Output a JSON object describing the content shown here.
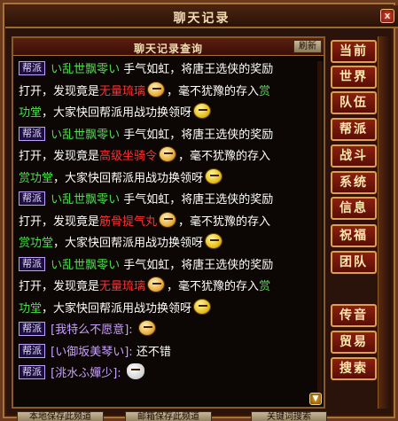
{
  "window": {
    "title": "聊天记录",
    "close_label": "x"
  },
  "panel": {
    "title": "聊天记录查询",
    "refresh_label": "刷新"
  },
  "channel_tag": "帮派",
  "messages": {
    "m1": {
      "player": "い乱世飘零い",
      "a": "手气如虹，将唐王选侠的奖励",
      "b": "打开，发现竟是",
      "item": "无量琉璃",
      "c": "，毫不犹豫的存入",
      "d": "赏",
      "e": "功堂",
      "f": "，大家快回帮派用战功换领呀"
    },
    "m2": {
      "player": "い乱世飘零い",
      "a": "手气如虹，将唐王选侠的奖励",
      "b": "打开，发现竟是",
      "item": "高级坐骑令",
      "c": "，毫不犹豫的存入",
      "d": "赏功堂",
      "f": "，大家快回帮派用战功换领呀"
    },
    "m3": {
      "player": "い乱世飘零い",
      "a": "手气如虹，将唐王选侠的奖励",
      "b": "打开，发现竟是",
      "item": "筋骨提气丸",
      "c": "，毫不犹豫的存入",
      "d": "赏功堂",
      "f": "，大家快回帮派用战功换领呀"
    },
    "m4": {
      "player": "い乱世飘零い",
      "a": "手气如虹，将唐王选侠的奖励",
      "b": "打开，发现竟是",
      "item": "无量琉璃",
      "c": "，毫不犹豫的存",
      "c2": "入",
      "d": "赏",
      "e": "功堂",
      "f": "，大家快回帮派用战功换领呀"
    },
    "m5": {
      "text": "[我特么不愿意]:"
    },
    "m6": {
      "text": "[い御坂美琴い]:",
      "msg": "还不错"
    },
    "m7": {
      "text": "[洮水ふ嬋少]:"
    }
  },
  "side_menu": [
    "当前",
    "世界",
    "队伍",
    "帮派",
    "战斗",
    "系统",
    "信息",
    "祝福",
    "团队",
    "传音",
    "贸易",
    "搜索"
  ],
  "bottom_buttons": [
    "本地保存此频道",
    "邮箱保存此频道",
    "关键词搜索"
  ],
  "emoji_icons": [
    "grin-emoji-icon",
    "yellow-smile-icon",
    "white-ghost-icon"
  ]
}
